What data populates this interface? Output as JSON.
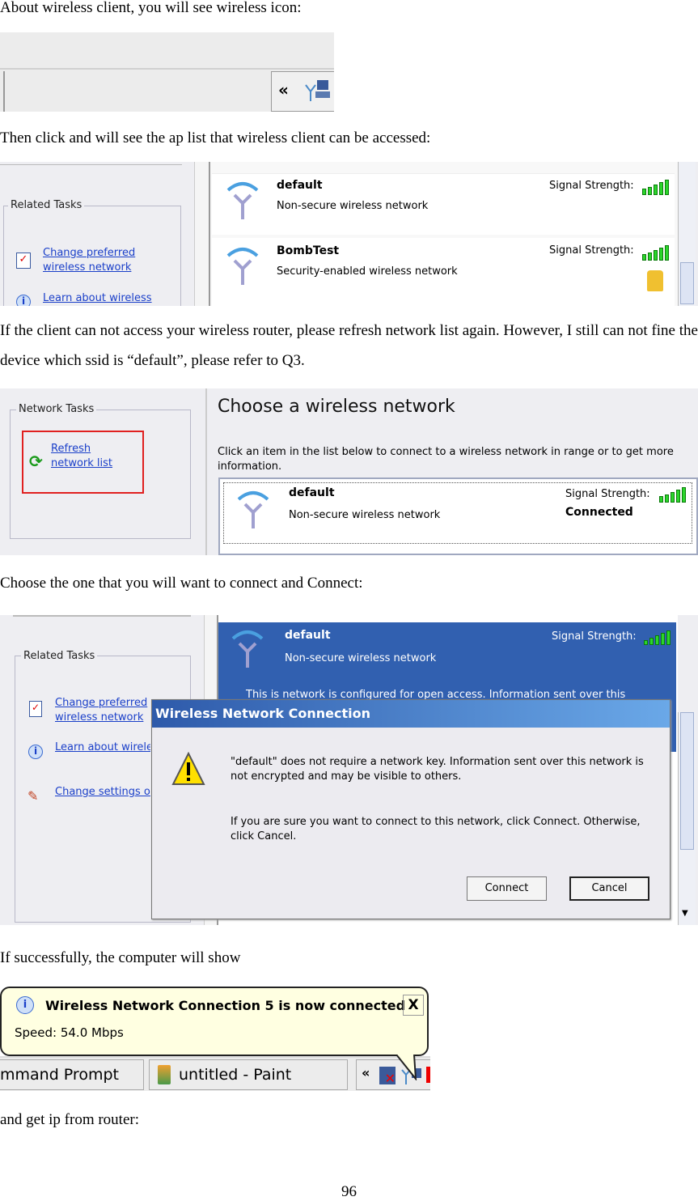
{
  "paragraphs": {
    "p1": "About wireless client, you will see wireless icon:",
    "p2": "Then click and will see the ap list that wireless client can be accessed:",
    "p3": "If the client can not access your wireless router, please refresh network list again. However, I still can not fine the device which ssid is “default”, please refer to Q3.",
    "p4": "Choose the one that you will want to connect and Connect:",
    "p5": "If successfully, the computer will show",
    "p6": "and get ip from router:"
  },
  "shot1": {
    "chevron": "«",
    "icon": "wireless-network-icon"
  },
  "shot2": {
    "group_title": "Related Tasks",
    "links": [
      "Change preferred wireless network",
      "Learn about wireless"
    ],
    "networks": [
      {
        "ssid": "default",
        "desc": "Non-secure wireless network",
        "signal_label": "Signal Strength:",
        "signal_bars": 5
      },
      {
        "ssid": "BombTest",
        "desc": "Security-enabled wireless network",
        "signal_label": "Signal Strength:",
        "signal_bars": 5,
        "locked": true
      }
    ]
  },
  "shot3": {
    "group_title": "Network Tasks",
    "refresh_link": "Refresh network list",
    "heading": "Choose a wireless network",
    "instructions": "Click an item in the list below to connect to a wireless network in range or to get more information.",
    "network": {
      "ssid": "default",
      "desc": "Non-secure wireless network",
      "signal_label": "Signal Strength:",
      "status": "Connected",
      "signal_bars": 5
    }
  },
  "shot4": {
    "group_title": "Related Tasks",
    "links": [
      "Change preferred wireless network",
      "Learn about wireless networking",
      "Change settings of connection"
    ],
    "network": {
      "ssid": "default",
      "desc": "Non-secure wireless network",
      "signal_label": "Signal Strength:",
      "info": "This is network is configured for open access. Information sent over this"
    },
    "dialog": {
      "title": "Wireless Network Connection",
      "msg1": "\"default\" does not require a network key. Information sent over this network is not encrypted and may be visible to others.",
      "msg2": "If you are sure you want to connect to this network, click Connect. Otherwise, click Cancel.",
      "connect": "Connect",
      "cancel": "Cancel"
    }
  },
  "shot5": {
    "balloon_title": "Wireless Network Connection 5 is now connected",
    "balloon_text": "Speed: 54.0 Mbps",
    "close": "X",
    "taskbar": [
      "mmand Prompt",
      "untitled - Paint"
    ],
    "chevron": "«"
  },
  "page_number": "96",
  "colors": {
    "xp_blue": "#3160b0",
    "link": "#1a3fc9",
    "balloon": "#ffffe1",
    "panel": "#eeeef2"
  }
}
